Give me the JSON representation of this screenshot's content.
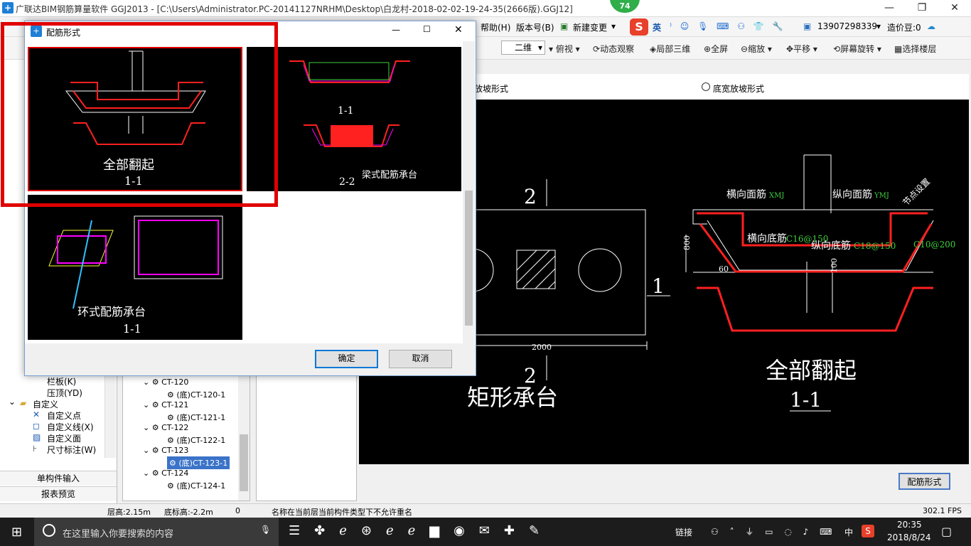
{
  "window": {
    "title": "广联达BIM钢筋算量软件 GGJ2013 - [C:\\Users\\Administrator.PC-20141127NRHM\\Desktop\\白龙村-2018-02-02-19-24-35(2666版).GGJ12]",
    "badge": "74"
  },
  "menubar": {
    "help": "帮助(H)",
    "version": "版本号(B)",
    "new_change": "新建变更",
    "ime_en": "英",
    "phone": "13907298339",
    "price": "造价豆:0"
  },
  "toolbar": {
    "view2d": "二维",
    "topview": "俯视",
    "dynamic": "动态观察",
    "local3d": "局部三维",
    "fullscreen": "全屏",
    "zoom": "缩放",
    "pan": "平移",
    "rotate": "屏幕旋转",
    "select_floor": "选择楼层"
  },
  "left_panel": {
    "items": [
      "栏板(K)",
      "压顶(YD)",
      "自定义",
      "自定义点",
      "自定义线(X)",
      "自定义面",
      "尺寸标注(W)"
    ],
    "btn_single": "单构件输入",
    "btn_report": "报表预览"
  },
  "tree": {
    "items": [
      "CT-120",
      "(底)CT-120-1",
      "CT-121",
      "(底)CT-121-1",
      "CT-122",
      "(底)CT-122-1",
      "CT-123",
      "(底)CT-123-1",
      "CT-124",
      "(底)CT-124-1"
    ]
  },
  "draw": {
    "radio1": "底放坡形式",
    "radio2": "底宽放坡形式",
    "config_button": "配筋形式",
    "cad": {
      "label_2_top": "2",
      "label_1": "1",
      "label_2_bot": "2",
      "title": "矩形承台",
      "dim": "2000",
      "hm": "横向面筋",
      "hm_code": "XMJ",
      "zm": "纵向面筋",
      "zm_code": "YMJ",
      "node": "节点设置",
      "hd": "横向底筋",
      "hd_val": "C16@150",
      "zd": "纵向底筋",
      "zd_val": "C18@150",
      "side_val": "C10@200",
      "h800": "800",
      "a60": "60",
      "d100": "100",
      "big_title": "全部翻起",
      "section": "1-1"
    }
  },
  "dialog": {
    "title": "配筋形式",
    "ok": "确定",
    "cancel": "取消",
    "opt1": {
      "title": "全部翻起",
      "section": "1-1"
    },
    "opt2": {
      "title": "梁式配筋承台",
      "s1": "1-1",
      "s2": "2-2"
    },
    "opt3": {
      "title": "环式配筋承台",
      "section": "1-1"
    }
  },
  "status": {
    "floor_h": "层高:2.15m",
    "bottom_h": "底标高:-2.2m",
    "zero": "0",
    "msg": "名称在当前层当前构件类型下不允许重名",
    "fps": "302.1 FPS"
  },
  "taskbar": {
    "search": "在这里输入你要搜索的内容",
    "link": "链接",
    "lang": "中",
    "time": "20:35",
    "date": "2018/8/24"
  }
}
